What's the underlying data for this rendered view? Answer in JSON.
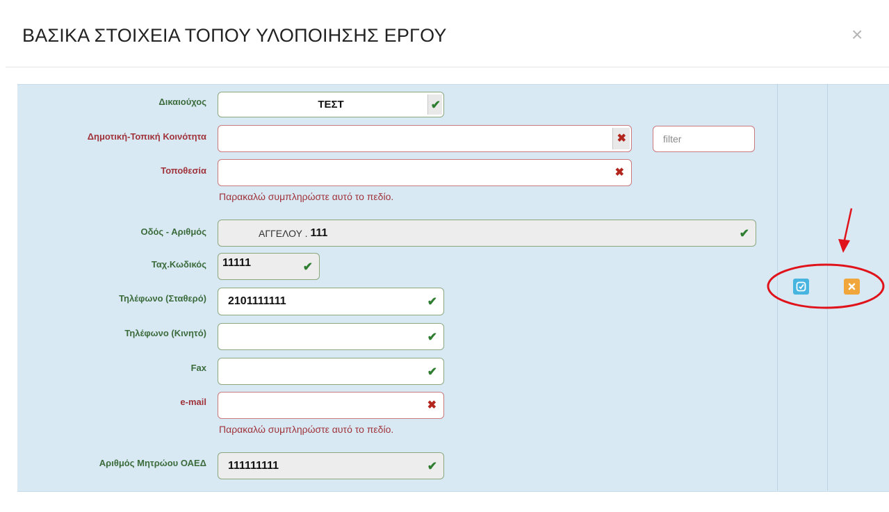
{
  "dialog": {
    "title": "ΒΑΣΙΚΑ ΣΤΟΙΧΕΙΑ ΤΟΠΟΥ ΥΛΟΠΟΙΗΣΗΣ ΕΡΓΟΥ",
    "close_symbol": "×"
  },
  "form": {
    "beneficiary": {
      "label": "Δικαιούχος",
      "value": "ΤΕΣΤ"
    },
    "community": {
      "label": "Δημοτική-Τοπική Κοινότητα",
      "value": "",
      "filter_placeholder": "filter"
    },
    "location": {
      "label": "Τοποθεσία",
      "value": "",
      "hint": "Παρακαλώ συμπληρώστε αυτό το πεδίο."
    },
    "street": {
      "label": "Οδός - Αριθμός",
      "value_street": "ΑΓΓΕΛΟΥ .",
      "value_number": "111"
    },
    "postal_code": {
      "label": "Ταχ.Κωδικός",
      "value": "11111"
    },
    "phone_landline": {
      "label": "Τηλέφωνο (Σταθερό)",
      "value": "2101111111"
    },
    "phone_mobile": {
      "label": "Τηλέφωνο (Κινητό)",
      "value": ""
    },
    "fax": {
      "label": "Fax",
      "value": ""
    },
    "email": {
      "label": "e-mail",
      "value": "",
      "hint": "Παρακαλώ συμπληρώστε αυτό το πεδίο."
    },
    "oaed_number": {
      "label": "Αριθμός Μητρώου ΟΑΕΔ",
      "value": "111111111"
    }
  },
  "actions": {
    "edit_icon": "edit-icon",
    "cancel_icon": "cancel-icon"
  },
  "colors": {
    "panel_bg": "#d8e9f4",
    "valid_label": "#3b6b3b",
    "invalid_label": "#a0333a",
    "edit_button": "#48b4e0",
    "cancel_button": "#f0a63b",
    "annotation": "#e0121a"
  }
}
